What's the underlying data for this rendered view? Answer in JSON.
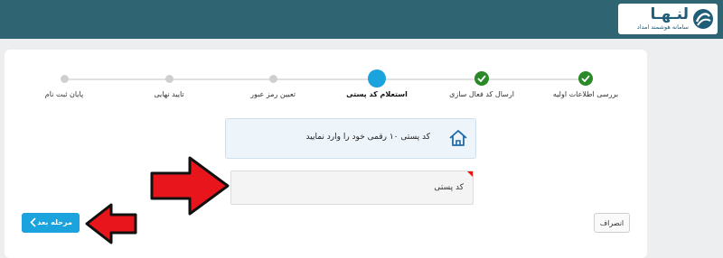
{
  "brand": {
    "name": "لنـهـا",
    "subtitle": "سامانه هوشمند امداد",
    "colors": {
      "header": "#2f6473",
      "accent": "#1aa3dc",
      "success": "#2a8a2a",
      "annotation_arrow": "#e8161c"
    }
  },
  "stepper": {
    "steps": [
      {
        "label": "بررسی اطلاعات اولیه",
        "state": "done"
      },
      {
        "label": "ارسال کد فعال سازی",
        "state": "done"
      },
      {
        "label": "استعلام کد پستی",
        "state": "active"
      },
      {
        "label": "تعیین رمز عبور",
        "state": "pending"
      },
      {
        "label": "تایید نهایی",
        "state": "pending"
      },
      {
        "label": "پایان ثبت نام",
        "state": "pending"
      }
    ]
  },
  "info": {
    "message": "کد پستی ۱۰ رقمی خود را وارد نمایید",
    "icon": "home-icon"
  },
  "postal_input": {
    "placeholder": "کد پستی",
    "value": ""
  },
  "actions": {
    "cancel_label": "انصراف",
    "next_label": "مرحله بعد"
  }
}
